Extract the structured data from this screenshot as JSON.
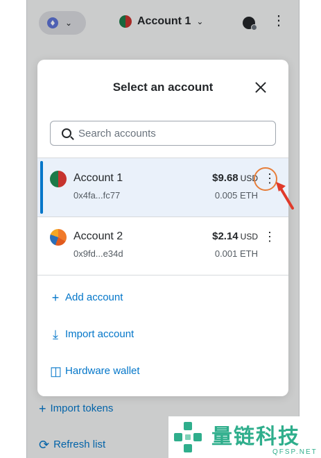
{
  "header": {
    "network_icon": "ethereum-icon",
    "account_label": "Account 1",
    "globe_icon": "globe-icon",
    "menu_icon": "kebab-menu-icon"
  },
  "background_links": {
    "import_tokens": "Import tokens",
    "refresh_list": "Refresh list"
  },
  "modal": {
    "title": "Select an account",
    "close_icon": "close-icon",
    "search": {
      "placeholder": "Search accounts",
      "value": ""
    },
    "accounts": [
      {
        "name": "Account 1",
        "address": "0x4fa...fc77",
        "balance": "$9.68",
        "currency": "USD",
        "eth": "0.005 ETH",
        "selected": true
      },
      {
        "name": "Account 2",
        "address": "0x9fd...e34d",
        "balance": "$2.14",
        "currency": "USD",
        "eth": "0.001 ETH",
        "selected": false
      }
    ],
    "actions": {
      "add_account": "Add account",
      "import_account": "Import account",
      "hardware_wallet": "Hardware wallet"
    }
  },
  "watermark": {
    "text": "量链科技",
    "sub": "QFSP.NET"
  },
  "colors": {
    "accent": "#0376c9",
    "selected_bg": "#eaf1fa",
    "annotation": "#e67e3a",
    "watermark": "#2fae8c"
  }
}
